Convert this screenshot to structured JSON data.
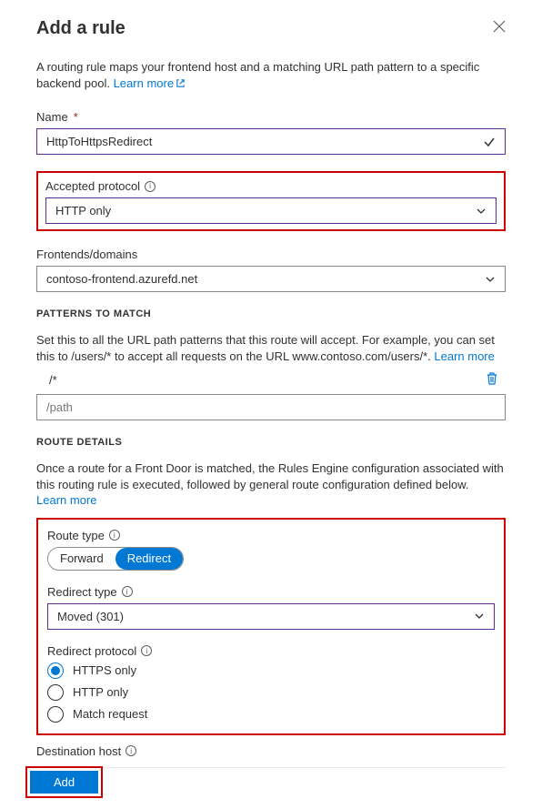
{
  "title": "Add a rule",
  "description_pre": "A routing rule maps your frontend host and a matching URL path pattern to a specific backend pool. ",
  "learn_more": "Learn more",
  "name": {
    "label": "Name",
    "value": "HttpToHttpsRedirect"
  },
  "accepted_protocol": {
    "label": "Accepted protocol",
    "value": "HTTP only"
  },
  "frontends": {
    "label": "Frontends/domains",
    "value": "contoso-frontend.azurefd.net"
  },
  "patterns": {
    "heading": "PATTERNS TO MATCH",
    "desc_pre": "Set this to all the URL path patterns that this route will accept. For example, you can set this to /users/* to accept all requests on the URL www.contoso.com/users/*. ",
    "value": "/*",
    "placeholder": "/path"
  },
  "route": {
    "heading": "ROUTE DETAILS",
    "desc_pre": "Once a route for a Front Door is matched, the Rules Engine configuration associated with this routing rule is executed, followed by general route configuration defined below. ",
    "type_label": "Route type",
    "forward": "Forward",
    "redirect": "Redirect",
    "redirect_type_label": "Redirect type",
    "redirect_type_value": "Moved (301)",
    "redirect_protocol_label": "Redirect protocol",
    "opt_https": "HTTPS only",
    "opt_http": "HTTP only",
    "opt_match": "Match request"
  },
  "destination_host_label": "Destination host",
  "add_label": "Add"
}
